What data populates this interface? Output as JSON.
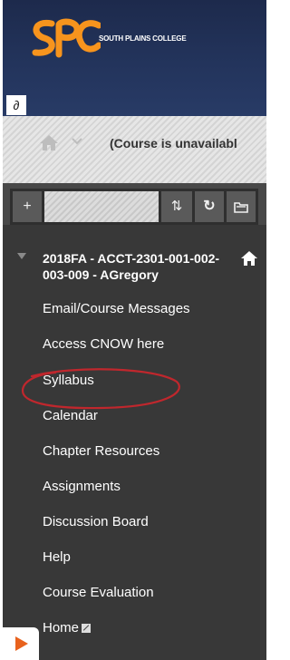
{
  "banner": {
    "college_name": "SOUTH PLAINS COLLEGE",
    "logo_text": "SPC",
    "brand_color": "#f7941d",
    "link_icon": "∂"
  },
  "breadcrumb": {
    "status": "(Course is unavailabl"
  },
  "toolbar": {
    "add_label": "+",
    "sort_label": "⇅",
    "refresh_label": "↻",
    "folder_icon": "folder-icon"
  },
  "course": {
    "title": "2018FA - ACCT-2301-001-002-003-009 - AGregory"
  },
  "menu": {
    "items": [
      {
        "label": "Email/Course Messages"
      },
      {
        "label": "Access CNOW here"
      },
      {
        "label": "Syllabus"
      },
      {
        "label": "Calendar"
      },
      {
        "label": "Chapter Resources"
      },
      {
        "label": "Assignments"
      },
      {
        "label": "Discussion Board"
      },
      {
        "label": "Help"
      },
      {
        "label": "Course Evaluation"
      },
      {
        "label": "Home"
      }
    ]
  },
  "annotation_color": "#c0272d"
}
